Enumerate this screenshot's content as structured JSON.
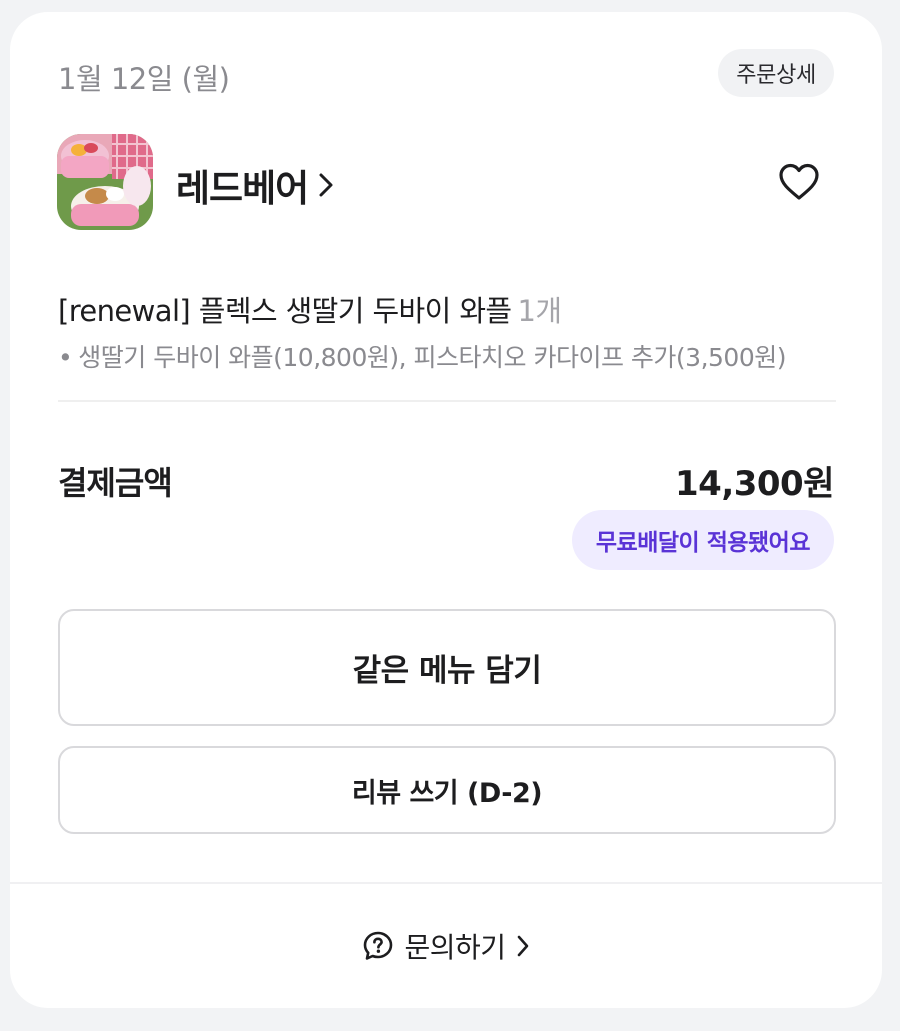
{
  "order": {
    "date": "1월 12일 (월)",
    "detail_label": "주문상세"
  },
  "store": {
    "name": "레드베어",
    "thumbnail_icon": "store-photo-icon"
  },
  "item": {
    "title": "[renewal] 플렉스 생딸기 두바이 와플",
    "quantity": "1개",
    "options": "생딸기 두바이 와플(10,800원), 피스타치오 카다이프 추가(3,500원)"
  },
  "payment": {
    "label": "결제금액",
    "amount": "14,300원",
    "free_delivery_badge": "무료배달이 적용됐어요"
  },
  "actions": {
    "reorder_label": "같은 메뉴 담기",
    "review_label": "리뷰 쓰기 (D-2)"
  },
  "footer": {
    "inquiry_label": "문의하기"
  },
  "colors": {
    "accent": "#5a33d6",
    "badge_bg": "#efecff",
    "muted_text": "#8a8a8f"
  }
}
